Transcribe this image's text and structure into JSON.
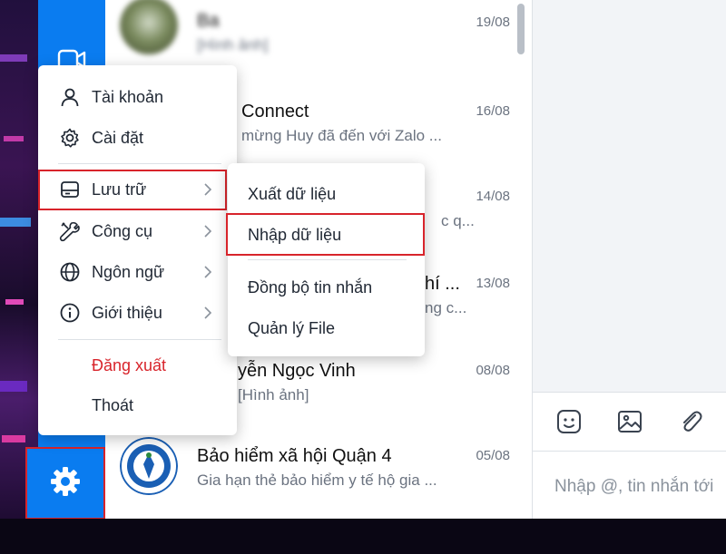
{
  "colors": {
    "accent": "#0a7cf0",
    "highlight": "#d8242b",
    "logout": "#d8242b"
  },
  "nav": {
    "icons": [
      {
        "name": "video-icon"
      }
    ],
    "settings_icon": "gear-icon"
  },
  "conversations": [
    {
      "name": "Ba",
      "preview": "[Hình ảnh]",
      "date": "19/08",
      "blurred": true
    },
    {
      "name": "Connect",
      "preview": "mừng Huy đã đến với Zalo ...",
      "date": "16/08",
      "blurred": false
    },
    {
      "name": "",
      "preview": "c q...",
      "date": "14/08",
      "blurred": false
    },
    {
      "name": "hí ...",
      "preview": "ng c...",
      "date": "13/08",
      "blurred": false
    },
    {
      "name": "yễn Ngọc Vinh",
      "preview": "[Hình ảnh]",
      "date": "08/08",
      "blurred": false
    },
    {
      "name": "Bảo hiểm xã hội Quận 4",
      "preview": "Gia hạn thẻ bảo hiểm y tế hộ gia ...",
      "date": "05/08",
      "blurred": false
    }
  ],
  "main_menu": {
    "account": "Tài khoản",
    "settings": "Cài đặt",
    "storage": "Lưu trữ",
    "tools": "Công cụ",
    "language": "Ngôn ngữ",
    "about": "Giới thiệu",
    "logout": "Đăng xuất",
    "exit": "Thoát"
  },
  "storage_submenu": {
    "export": "Xuất dữ liệu",
    "import": "Nhập dữ liệu",
    "sync": "Đồng bộ tin nhắn",
    "files": "Quản lý File"
  },
  "chat": {
    "input_placeholder": "Nhập @, tin nhắn tới"
  }
}
